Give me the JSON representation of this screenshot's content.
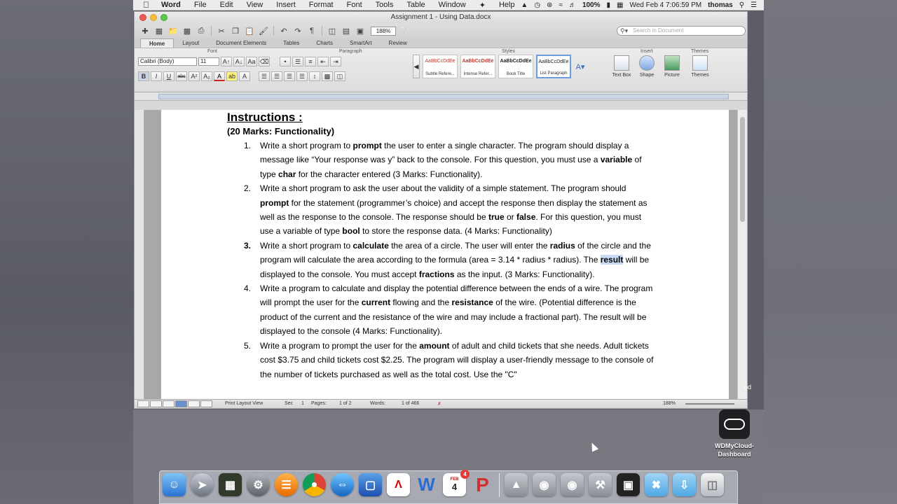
{
  "menubar": {
    "app": "Word",
    "items": [
      "File",
      "Edit",
      "View",
      "Insert",
      "Format",
      "Font",
      "Tools",
      "Table",
      "Window",
      "Help"
    ],
    "battery": "100%",
    "datetime": "Wed Feb 4  7:06:59 PM",
    "user": "thomas"
  },
  "window": {
    "title": "Assignment 1 - Using Data.docx",
    "zoom": "188%",
    "search_placeholder": "Search in Document"
  },
  "ribbon_tabs": [
    "Home",
    "Layout",
    "Document Elements",
    "Tables",
    "Charts",
    "SmartArt",
    "Review"
  ],
  "ribbon": {
    "font_group": "Font",
    "paragraph_group": "Paragraph",
    "styles_group": "Styles",
    "insert_group": "Insert",
    "themes_group": "Themes",
    "font_name": "Calibri (Body)",
    "font_size": "11",
    "styles": [
      {
        "preview": "AaBbCcDdEe",
        "name": "Subtle Refere..."
      },
      {
        "preview": "AaBbCcDdEe",
        "name": "Intense Refer..."
      },
      {
        "preview": "AaBbCcDdEe",
        "name": "Book Title"
      },
      {
        "preview": "AaBbCcDdEe",
        "name": "List Paragraph"
      }
    ],
    "insert_buttons": [
      "Text Box",
      "Shape",
      "Picture"
    ],
    "themes_button": "Themes"
  },
  "document": {
    "heading": "Instructions :",
    "subheading": "(20 Marks: Functionality)",
    "items": [
      {
        "num": "1.",
        "bold_num": false,
        "parts": [
          [
            "Write a short program to ",
            false
          ],
          [
            "prompt",
            true
          ],
          [
            " the user to enter a single character. The program should display a message like “Your response was y” back to the console. For this question, you must use a ",
            false
          ],
          [
            "variable",
            true
          ],
          [
            " of type ",
            false
          ],
          [
            "char",
            true
          ],
          [
            " for the character entered (3 Marks: Functionality).",
            false
          ]
        ]
      },
      {
        "num": "2.",
        "bold_num": false,
        "parts": [
          [
            "Write a short program to ask the user about the validity of a simple statement. The program should ",
            false
          ],
          [
            "prompt",
            true
          ],
          [
            " for the statement (programmer’s choice) and accept the response then display the statement as well as the response to the console. The response should be ",
            false
          ],
          [
            "true",
            true
          ],
          [
            " or ",
            false
          ],
          [
            "false",
            true
          ],
          [
            ". For this question, you must use a variable of type ",
            false
          ],
          [
            "bool",
            true
          ],
          [
            " to store the response data. (4 Marks: Functionality)",
            false
          ]
        ]
      },
      {
        "num": "3.",
        "bold_num": true,
        "parts": [
          [
            "Write a short program to ",
            false
          ],
          [
            "calculate",
            true
          ],
          [
            " the area of a circle. The user will enter the ",
            false
          ],
          [
            "radius",
            true
          ],
          [
            " of the circle and the program will calculate the area according to the formula (area = 3.14 * radius * radius). The ",
            false
          ],
          [
            "result",
            "hl"
          ],
          [
            " will be displayed to the console. You must accept ",
            false
          ],
          [
            "fractions",
            true
          ],
          [
            " as the input. (3 Marks: Functionality).",
            false
          ]
        ]
      },
      {
        "num": "4.",
        "bold_num": false,
        "parts": [
          [
            "Write a program to calculate and display the potential difference between the ends of a wire. The program will prompt the user for the ",
            false
          ],
          [
            "current",
            true
          ],
          [
            " flowing and the ",
            false
          ],
          [
            "resistance",
            true
          ],
          [
            " of the wire. (Potential difference is the product of the current and the resistance of the wire and may include a fractional part). The result will be displayed to the console (4 Marks: Functionality).",
            false
          ]
        ]
      },
      {
        "num": "5.",
        "bold_num": false,
        "parts": [
          [
            "Write a program to prompt the user for the ",
            false
          ],
          [
            "amount",
            true
          ],
          [
            " of adult and child tickets that she needs. Adult tickets cost $3.75 and child tickets cost $2.25. The program will display a user-friendly message to the console of the number of tickets purchased as well as the total cost. Use the \"C\"",
            false
          ]
        ]
      }
    ]
  },
  "statusbar": {
    "view": "Print Layout View",
    "sec_label": "Sec",
    "sec_value": "1",
    "pages_label": "Pages:",
    "pages_value": "1 of 2",
    "words_label": "Words:",
    "words_value": "1 of 466",
    "zoom": "188%"
  },
  "desktop": {
    "icon_label_1": "WDMyCloud-",
    "icon_label_2": "Dashboard",
    "edge_text": "ud"
  },
  "dock": {
    "calendar_month": "FEB",
    "calendar_day": "4",
    "calendar_badge": "4"
  }
}
